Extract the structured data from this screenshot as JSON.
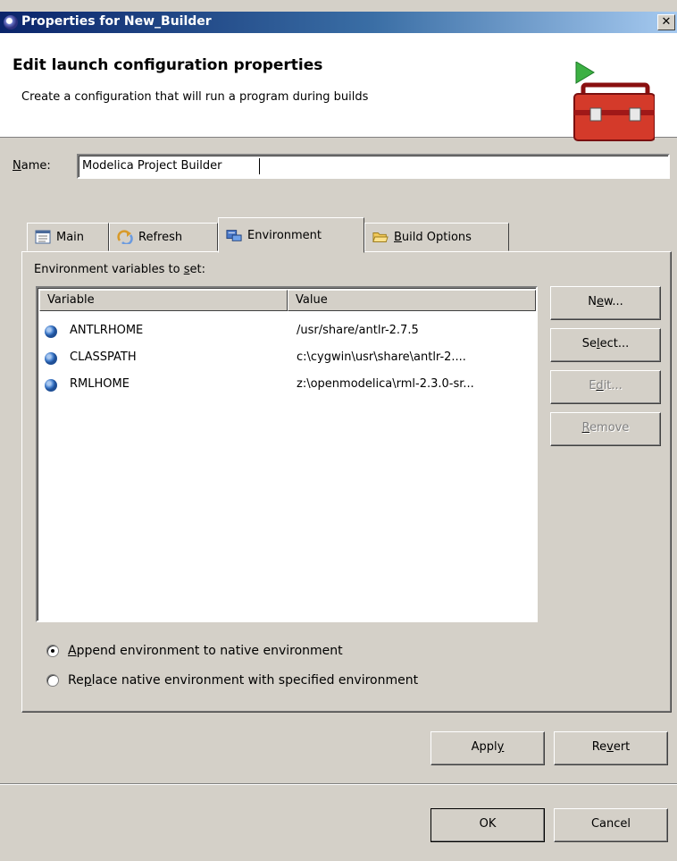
{
  "window": {
    "title": "Properties for New_Builder",
    "close_glyph": "✕"
  },
  "header": {
    "title": "Edit launch configuration properties",
    "description": "Create a configuration that will run a program during builds",
    "icon": "toolbox-run-icon"
  },
  "name_field": {
    "label_pre": "",
    "label_mnemonic": "N",
    "label_post": "ame:",
    "value": "Modelica Project Builder"
  },
  "tabs": [
    {
      "label": "Main",
      "icon": "main-tab-icon"
    },
    {
      "label": "Refresh",
      "icon": "refresh-icon"
    },
    {
      "label": "Environment",
      "icon": "environment-icon"
    },
    {
      "label_mnemonic": "B",
      "label_rest": "uild Options",
      "icon": "folder-icon"
    }
  ],
  "env_label": {
    "pre": "Environment variables to ",
    "mnemonic": "s",
    "post": "et:"
  },
  "table": {
    "columns": [
      "Variable",
      "Value"
    ],
    "rows": [
      {
        "variable": "ANTLRHOME",
        "value": "/usr/share/antlr-2.7.5"
      },
      {
        "variable": "CLASSPATH",
        "value": "c:\\cygwin\\usr\\share\\antlr-2...."
      },
      {
        "variable": "RMLHOME",
        "value": "z:\\openmodelica\\rml-2.3.0-sr..."
      }
    ]
  },
  "side_buttons": {
    "new": {
      "pre": "N",
      "mnemonic": "e",
      "post": "w..."
    },
    "select": {
      "pre": "Se",
      "mnemonic": "l",
      "post": "ect..."
    },
    "edit": {
      "pre": "E",
      "mnemonic": "d",
      "post": "it..."
    },
    "remove": {
      "pre": "",
      "mnemonic": "R",
      "post": "emove"
    }
  },
  "radios": [
    {
      "pre": "",
      "mnemonic": "A",
      "post": "ppend environment to native environment",
      "selected": true
    },
    {
      "pre": "Re",
      "mnemonic": "p",
      "post": "lace native environment with specified environment",
      "selected": false
    }
  ],
  "apply_button": {
    "pre": "Appl",
    "mnemonic": "y",
    "post": ""
  },
  "revert_button": {
    "pre": "Re",
    "mnemonic": "v",
    "post": "ert"
  },
  "ok_button": {
    "label": "OK"
  },
  "cancel_button": {
    "label": "Cancel"
  }
}
